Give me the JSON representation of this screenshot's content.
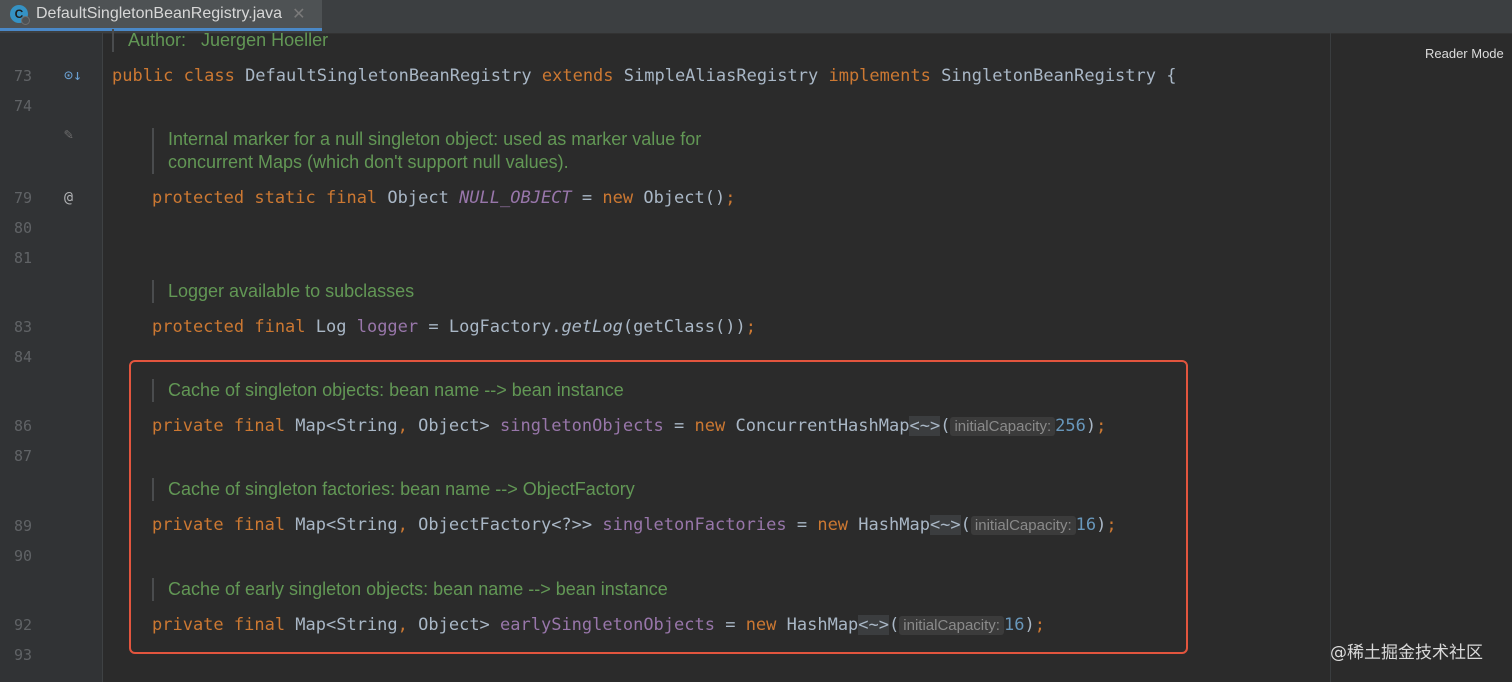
{
  "tab": {
    "title": "DefaultSingletonBeanRegistry.java",
    "icon": "class-icon",
    "close": "✕"
  },
  "toolbar": {
    "reader_mode": "Reader Mode"
  },
  "gutter": {
    "line_numbers": [
      "73",
      "74",
      "79",
      "80",
      "81",
      "83",
      "84",
      "86",
      "87",
      "89",
      "90",
      "92",
      "93"
    ],
    "icons": {
      "implements": "⊙↓",
      "edit": "✎",
      "annotation": "@"
    }
  },
  "docs": {
    "author": "Author:   Juergen Hoeller",
    "null_object_1": "Internal marker for a null singleton object: used as marker value for",
    "null_object_2": "concurrent Maps (which don't support null values).",
    "logger": "Logger available to subclasses",
    "singleton_objects": "Cache of singleton objects: bean name --> bean instance",
    "singleton_factories": "Cache of singleton factories: bean name --> ObjectFactory",
    "early_singleton": "Cache of early singleton objects: bean name --> bean instance"
  },
  "code": {
    "line73": {
      "kw1": "public class ",
      "name": "DefaultSingletonBeanRegistry ",
      "kw2": "extends ",
      "parent": "SimpleAliasRegistry ",
      "kw3": "implements ",
      "iface": "SingletonBeanRegistry {"
    },
    "line79": {
      "kw": "protected static final ",
      "type": "Object ",
      "field": "NULL_OBJECT",
      "eq": " = ",
      "new": "new ",
      "ctor": "Object()",
      "semi": ";"
    },
    "line83": {
      "kw": "protected final ",
      "type": "Log ",
      "field": "logger",
      "eq": " = LogFactory.",
      "method": "getLog",
      "rest": "(getClass())",
      "semi": ";"
    },
    "line86": {
      "kw": "private final ",
      "type1": "Map<String",
      "comma": ", ",
      "type2": "Object> ",
      "field": "singletonObjects",
      "eq": " = ",
      "new": "new ",
      "ctor": "ConcurrentHashMap",
      "diamond": "<~>",
      "open": "(",
      "hint": "initialCapacity:",
      "num": "256",
      "close": ")",
      "semi": ";"
    },
    "line89": {
      "kw": "private final ",
      "type1": "Map<String",
      "comma": ", ",
      "type2": "ObjectFactory<?>> ",
      "field": "singletonFactories",
      "eq": " = ",
      "new": "new ",
      "ctor": "HashMap",
      "diamond": "<~>",
      "open": "(",
      "hint": "initialCapacity:",
      "num": "16",
      "close": ")",
      "semi": ";"
    },
    "line92": {
      "kw": "private final ",
      "type1": "Map<String",
      "comma": ", ",
      "type2": "Object> ",
      "field": "earlySingletonObjects",
      "eq": " = ",
      "new": "new ",
      "ctor": "HashMap",
      "diamond": "<~>",
      "open": "(",
      "hint": "initialCapacity:",
      "num": "16",
      "close": ")",
      "semi": ";"
    }
  },
  "watermark": "@稀土掘金技术社区",
  "colors": {
    "keyword": "#cc7832",
    "field": "#9876aa",
    "comment": "#629755",
    "number": "#6897bb",
    "highlight_border": "#e2553e"
  }
}
